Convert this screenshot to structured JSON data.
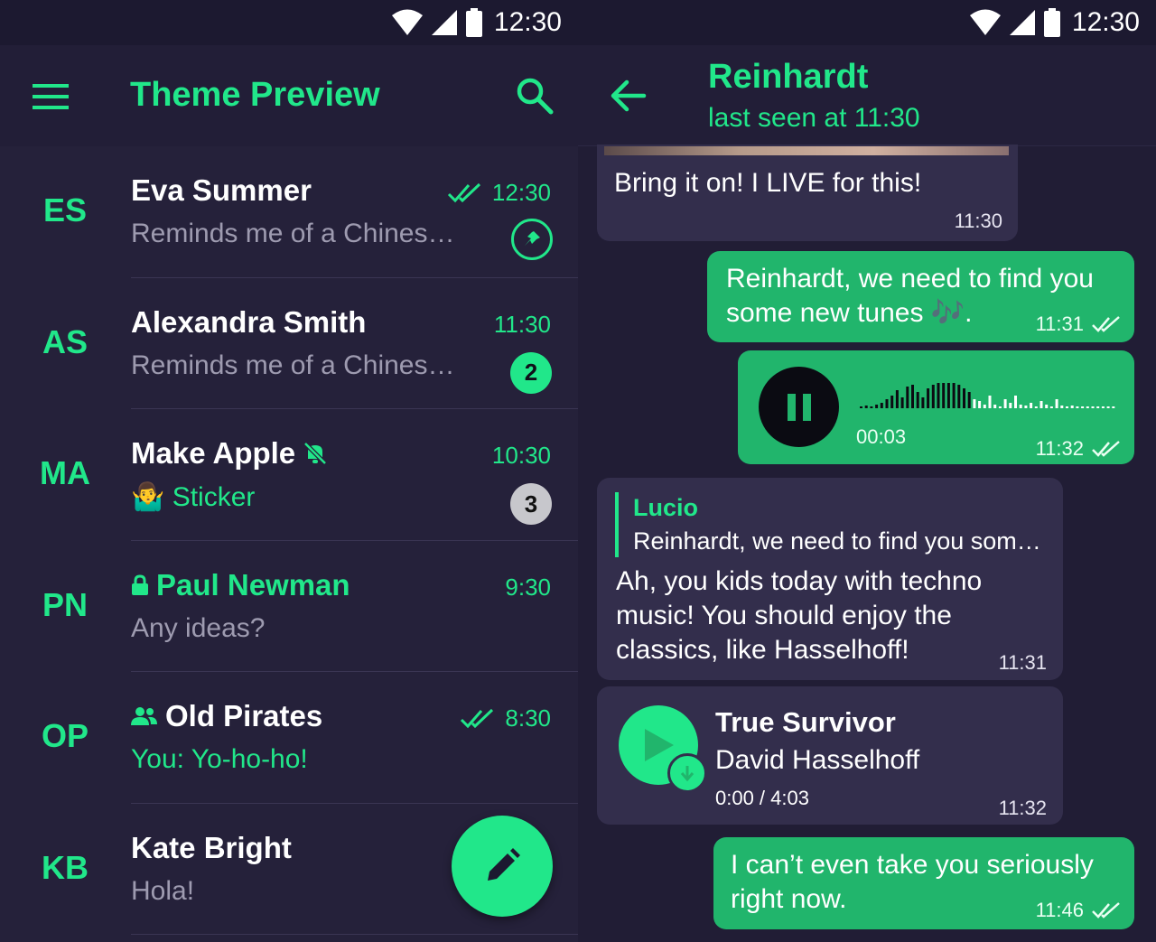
{
  "status_bar": {
    "time": "12:30"
  },
  "left_pane": {
    "title": "Theme Preview",
    "chats": [
      {
        "initials": "ES",
        "name": "Eva Summer",
        "preview": "Reminds me of a Chines…",
        "time": "12:30",
        "read": true,
        "pinned": true
      },
      {
        "initials": "AS",
        "name": "Alexandra Smith",
        "preview": "Reminds me of a Chines…",
        "time": "11:30",
        "unread": "2"
      },
      {
        "initials": "MA",
        "name": "Make Apple",
        "preview_emoji": "🤷‍♂️",
        "preview": "Sticker",
        "time": "10:30",
        "unread": "3",
        "muted": true
      },
      {
        "initials": "PN",
        "name": "Paul Newman",
        "preview": "Any ideas?",
        "time": "9:30",
        "secret": true
      },
      {
        "initials": "OP",
        "name": "Old Pirates",
        "preview_sender": "You:",
        "preview": "Yo-ho-ho!",
        "time": "8:30",
        "read": true,
        "group": true
      },
      {
        "initials": "KB",
        "name": "Kate Bright",
        "preview": "Hola!"
      }
    ]
  },
  "right_pane": {
    "contact": "Reinhardt",
    "status": "last seen at 11:30",
    "messages": {
      "m1": {
        "text": "Bring it on! I LIVE for this!",
        "time": "11:30"
      },
      "m2": {
        "line1": "Reinhardt, we need to find you",
        "line2": "some new tunes 🎶.",
        "time": "11:31"
      },
      "m3": {
        "duration": "00:03",
        "time": "11:32"
      },
      "m4": {
        "reply_name": "Lucio",
        "reply_text": "Reinhardt, we need to find you som…",
        "line1": "Ah, you kids today with techno",
        "line2": "music! You should enjoy the",
        "line3": "classics, like Hasselhoff!",
        "time": "11:31"
      },
      "m5": {
        "title": "True Survivor",
        "artist": "David Hasselhoff",
        "progress": "0:00 / 4:03",
        "time": "11:32"
      },
      "m6": {
        "line1": "I can’t even take you seriously",
        "line2": "right now.",
        "time": "11:46"
      }
    }
  },
  "colors": {
    "accent": "#21e78a",
    "out_bubble": "#21b56c",
    "in_bubble": "#332e4c",
    "background": "#221e37"
  }
}
